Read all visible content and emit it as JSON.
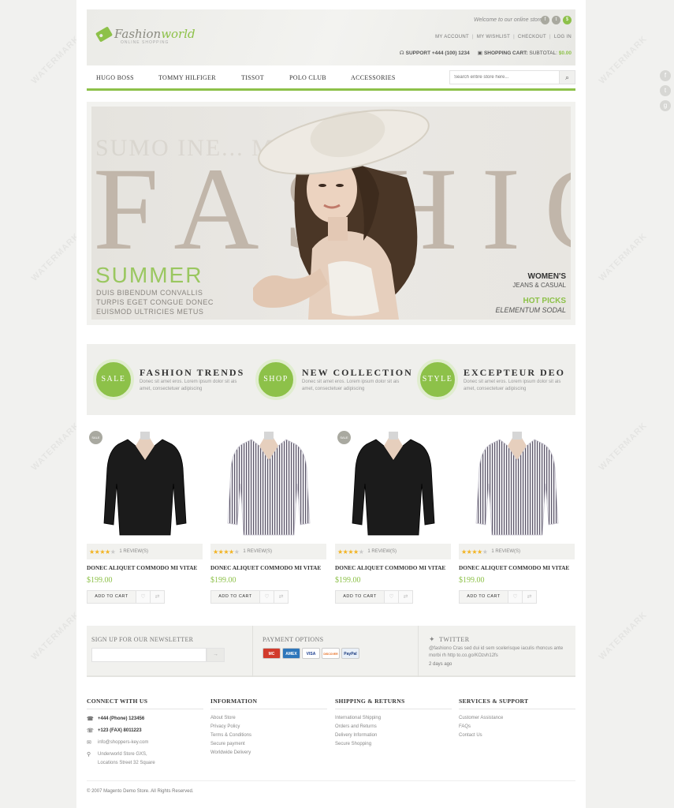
{
  "header": {
    "logo_main": "Fashion",
    "logo_accent": "world",
    "logo_sub": "ONLINE SHOPPING",
    "welcome": "Welcome to our online store!",
    "links": [
      "MY ACCOUNT",
      "MY WISHLIST",
      "CHECKOUT",
      "LOG IN"
    ],
    "support": "SUPPORT +444 (100) 1234",
    "cart_label": "SHOPPING CART:",
    "cart_subtotal_label": "SUBTOTAL:",
    "cart_total": "$0.00"
  },
  "nav": {
    "items": [
      "HUGO BOSS",
      "TOMMY HILFIGER",
      "TISSOT",
      "POLO CLUB",
      "ACCESSORIES"
    ],
    "search_placeholder": "Search entire store here..."
  },
  "banner": {
    "bg_sub": "SUMO INE... MPLECTITU",
    "big_word": "FASHIO",
    "summer": "SUMMER",
    "summer_lines": [
      "DUIS BIBENDUM CONVALLIS",
      "TURPIS EGET CONGUE DONEC",
      "EUISMOD ULTRICIES METUS"
    ],
    "right_title": "WOMEN'S",
    "right_sub": "JEANS & CASUAL",
    "right_hot": "HOT PICKS",
    "right_hot_sub": "ELEMENTUM SODAL"
  },
  "features": [
    {
      "circle": "SALE",
      "title": "FASHION TRENDS",
      "text": "Donec sit amet eros. Lorem ipsum dolor sit ais amet, consectetuer adipiscing"
    },
    {
      "circle": "SHOP",
      "title": "NEW COLLECTION",
      "text": "Donec sit amet eros. Lorem ipsum dolor sit ais amet, consectetuer adipiscing"
    },
    {
      "circle": "STYLE",
      "title": "EXCEPTEUR DEO",
      "text": "Donec sit amet eros. Lorem ipsum dolor sit ais amet, consectetuer adipiscing"
    }
  ],
  "products": [
    {
      "badge": "SALE",
      "color": "black",
      "rating": 4,
      "reviews": "1 REVIEW(S)",
      "name": "DONEC ALIQUET COMMODO MI VITAE",
      "price": "$199.00",
      "cart": "ADD TO CART"
    },
    {
      "badge": "",
      "color": "stripe",
      "rating": 4,
      "reviews": "1 REVIEW(S)",
      "name": "DONEC ALIQUET COMMODO MI VITAE",
      "price": "$199.00",
      "cart": "ADD TO CART"
    },
    {
      "badge": "SALE",
      "color": "black",
      "rating": 4,
      "reviews": "1 REVIEW(S)",
      "name": "DONEC ALIQUET COMMODO MI VITAE",
      "price": "$199.00",
      "cart": "ADD TO CART"
    },
    {
      "badge": "",
      "color": "stripe",
      "rating": 4,
      "reviews": "1 REVIEW(S)",
      "name": "DONEC ALIQUET COMMODO MI VITAE",
      "price": "$199.00",
      "cart": "ADD TO CART"
    }
  ],
  "newsletter": {
    "title": "SIGN UP FOR OUR NEWSLETTER"
  },
  "payment": {
    "title": "PAYMENT OPTIONS",
    "cards": [
      "MC",
      "AMEX",
      "VISA",
      "DISCOVER",
      "PayPal"
    ]
  },
  "twitter": {
    "title": "TWITTER",
    "text": "@fashiono Cras sed dui id sem scelerisque iaculis rhoncus ante morbi rh http to.co.go/KOzvh12fs",
    "date": "2 days ago"
  },
  "footer": {
    "contact_title": "CONNECT WITH US",
    "phone": "+444 (Phone) 123456",
    "fax": "+123 (FAX) 8011223",
    "email": "info@shoppers-key.com",
    "address1": "Underworld Store GXS,",
    "address2": "Locations Street 32 Square",
    "info_title": "INFORMATION",
    "info_links": [
      "About Store",
      "Privacy Policy",
      "Terms & Conditions",
      "Secure payment",
      "Worldwide Delivery"
    ],
    "ship_title": "SHIPPING & RETURNS",
    "ship_links": [
      "International Shipping",
      "Orders and Returns",
      "Delivery Information",
      "Secure Shopping"
    ],
    "serv_title": "SERVICES & SUPPORT",
    "serv_links": [
      "Customer Assistance",
      "FAQs",
      "Contact Us"
    ],
    "copyright": "© 2007 Magento Demo Store. All Rights Reserved."
  },
  "side_social": [
    "f",
    "t",
    "g"
  ],
  "colors": {
    "accent": "#8dc149",
    "text_dark": "#333333"
  },
  "watermark": "WATERMARK"
}
